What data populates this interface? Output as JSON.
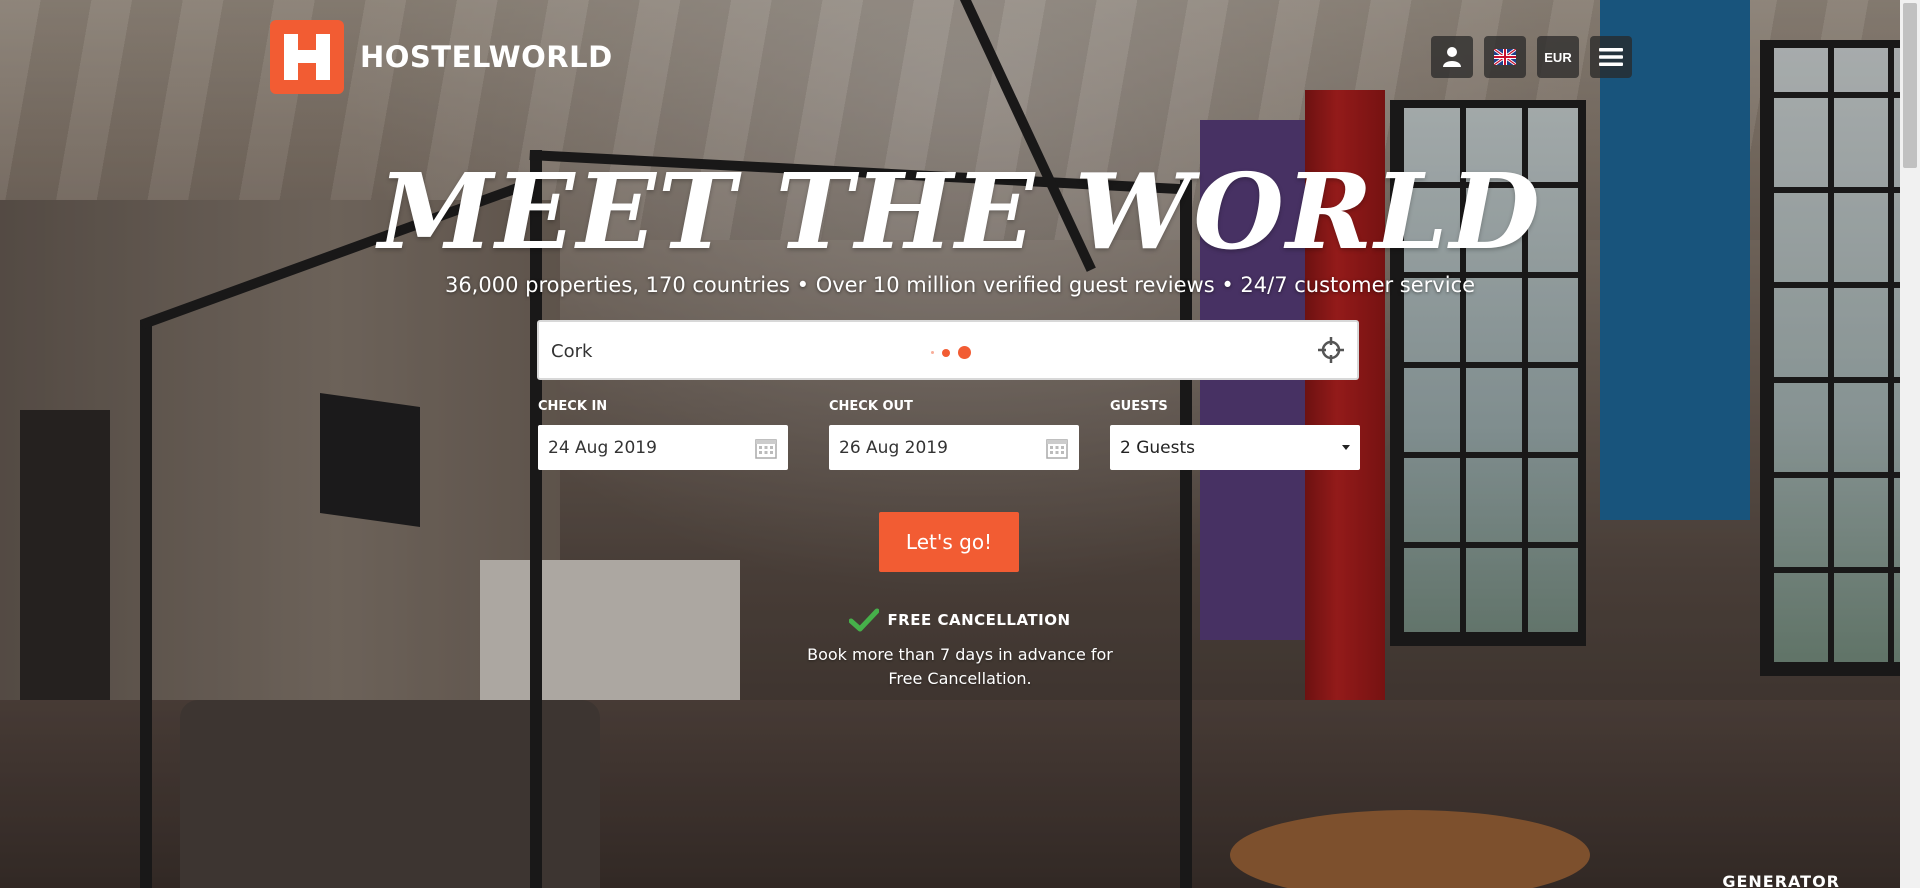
{
  "brand": {
    "name": "HOSTELWORLD",
    "accent_color": "#f25c33"
  },
  "header": {
    "account_icon": "user-icon",
    "language_icon": "uk-flag-icon",
    "currency_label": "EUR",
    "menu_icon": "hamburger-menu-icon"
  },
  "hero": {
    "title": "Meet the World",
    "subtitle": "36,000 properties, 170 countries • Over 10 million verified guest reviews • 24/7 customer service"
  },
  "search": {
    "value": "Cork",
    "locate_icon": "crosshair-icon"
  },
  "check_in": {
    "label": "Check In",
    "value": "24 Aug 2019"
  },
  "check_out": {
    "label": "Check Out",
    "value": "26 Aug 2019"
  },
  "guests": {
    "label": "Guests",
    "value": "2 Guests"
  },
  "submit": {
    "label": "Let's go!"
  },
  "free_cancellation": {
    "title": "FREE CANCELLATION",
    "line1": "Book more than 7 days in advance for",
    "line2": "Free Cancellation."
  },
  "footer_badge": {
    "text": "GENERATOR"
  }
}
